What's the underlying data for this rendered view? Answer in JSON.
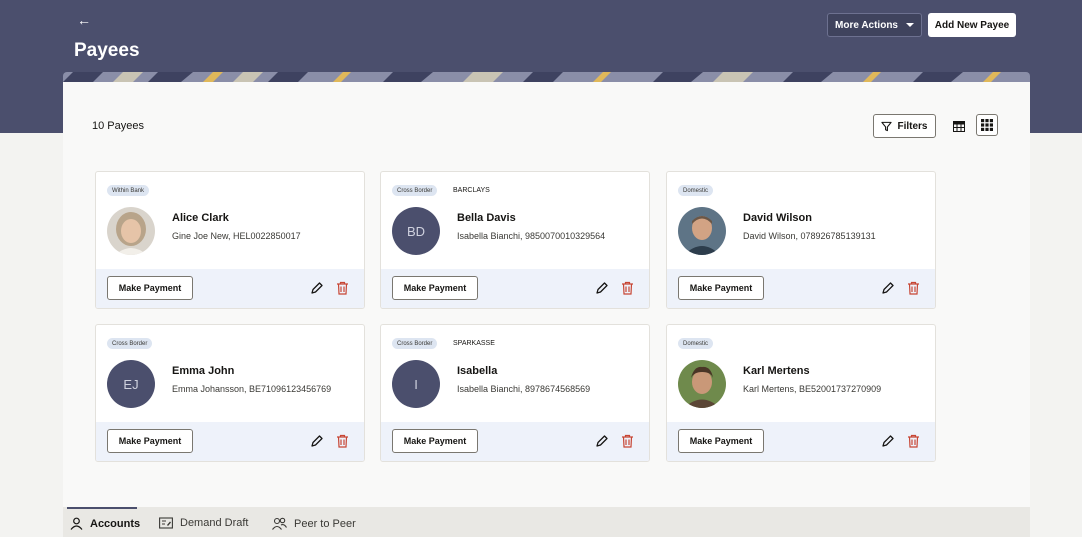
{
  "header": {
    "title": "Payees",
    "more_actions_label": "More Actions",
    "add_payee_label": "Add New Payee"
  },
  "toolbar": {
    "count_label": "10 Payees",
    "filters_label": "Filters"
  },
  "actions": {
    "make_payment_label": "Make Payment"
  },
  "payees": [
    {
      "type": "Within Bank",
      "bank": "",
      "name": "Alice Clark",
      "detail": "Gine Joe New, HEL0022850017",
      "initials": "",
      "photo": true
    },
    {
      "type": "Cross Border",
      "bank": "BARCLAYS",
      "name": "Bella Davis",
      "detail": "Isabella Bianchi, 9850070010329564",
      "initials": "BD",
      "photo": false
    },
    {
      "type": "Domestic",
      "bank": "",
      "name": "David Wilson",
      "detail": "David Wilson, 078926785139131",
      "initials": "",
      "photo": true
    },
    {
      "type": "Cross Border",
      "bank": "",
      "name": "Emma John",
      "detail": "Emma Johansson, BE71096123456769",
      "initials": "EJ",
      "photo": false
    },
    {
      "type": "Cross Border",
      "bank": "SPARKASSE",
      "name": "Isabella",
      "detail": "Isabella Bianchi, 8978674568569",
      "initials": "I",
      "photo": false
    },
    {
      "type": "Domestic",
      "bank": "",
      "name": "Karl Mertens",
      "detail": "Karl Mertens, BE52001737270909",
      "initials": "",
      "photo": true
    }
  ],
  "tabs": [
    {
      "label": "Accounts",
      "icon": "person-icon",
      "active": true
    },
    {
      "label": "Demand Draft",
      "icon": "draft-icon",
      "active": false
    },
    {
      "label": "Peer to Peer",
      "icon": "people-icon",
      "active": false
    }
  ],
  "colors": {
    "header": "#4b4f6d",
    "avatar": "#4b4f6d",
    "delete": "#c74634",
    "card_footer": "#eef2fa",
    "badge": "#dde5f1"
  }
}
